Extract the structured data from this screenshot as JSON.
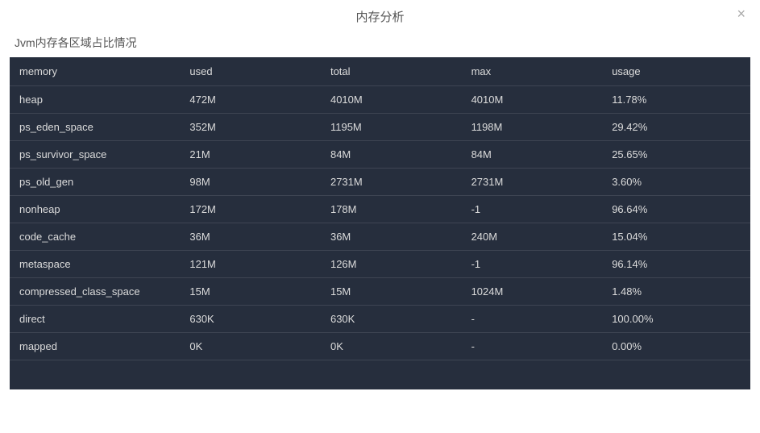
{
  "modal": {
    "title": "内存分析",
    "close_label": "×"
  },
  "subtitle": "Jvm内存各区域占比情况",
  "table": {
    "headers": {
      "memory": "memory",
      "used": "used",
      "total": "total",
      "max": "max",
      "usage": "usage"
    },
    "rows": [
      {
        "memory": "heap",
        "used": "472M",
        "total": "4010M",
        "max": "4010M",
        "usage": "11.78%"
      },
      {
        "memory": "ps_eden_space",
        "used": "352M",
        "total": "1195M",
        "max": "1198M",
        "usage": "29.42%"
      },
      {
        "memory": "ps_survivor_space",
        "used": "21M",
        "total": "84M",
        "max": "84M",
        "usage": "25.65%"
      },
      {
        "memory": "ps_old_gen",
        "used": "98M",
        "total": "2731M",
        "max": "2731M",
        "usage": "3.60%"
      },
      {
        "memory": "nonheap",
        "used": "172M",
        "total": "178M",
        "max": "-1",
        "usage": "96.64%"
      },
      {
        "memory": "code_cache",
        "used": "36M",
        "total": "36M",
        "max": "240M",
        "usage": "15.04%"
      },
      {
        "memory": "metaspace",
        "used": "121M",
        "total": "126M",
        "max": "-1",
        "usage": "96.14%"
      },
      {
        "memory": "compressed_class_space",
        "used": "15M",
        "total": "15M",
        "max": "1024M",
        "usage": "1.48%"
      },
      {
        "memory": "direct",
        "used": "630K",
        "total": "630K",
        "max": "-",
        "usage": "100.00%"
      },
      {
        "memory": "mapped",
        "used": "0K",
        "total": "0K",
        "max": "-",
        "usage": "0.00%"
      }
    ]
  }
}
